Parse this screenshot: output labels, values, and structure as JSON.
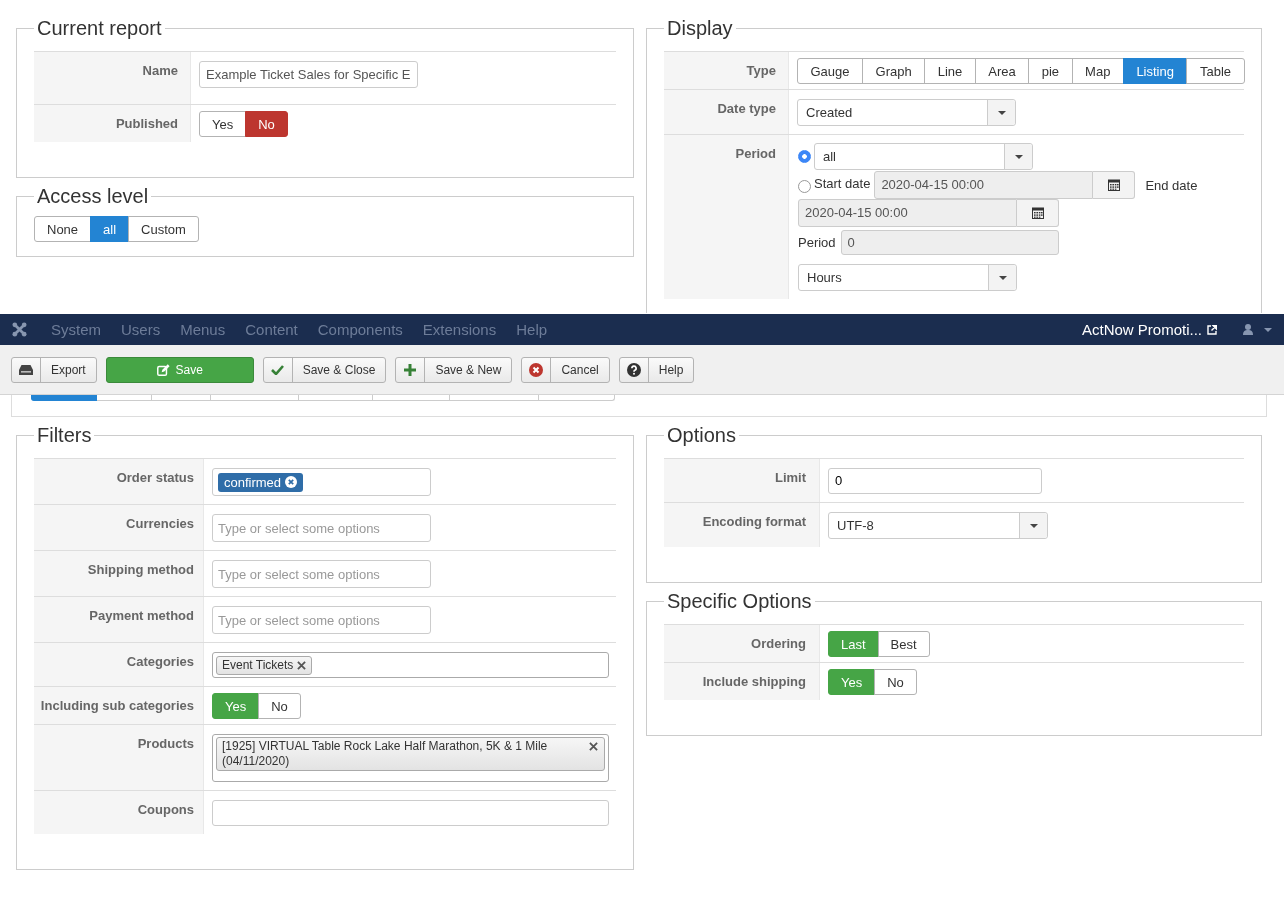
{
  "current_report": {
    "title": "Current report",
    "fields": [
      {
        "label": "Name",
        "kind": "text",
        "value": "Example Ticket Sales for Specific E"
      },
      {
        "label": "Published",
        "kind": "toggle",
        "options": [
          {
            "label": "Yes",
            "selected": false
          },
          {
            "label": "No",
            "selected": true,
            "color": "#bd362f"
          }
        ]
      }
    ]
  },
  "access_level": {
    "title": "Access level",
    "options": [
      {
        "label": "None",
        "selected": false
      },
      {
        "label": "all",
        "selected": true,
        "color": "#2384d3"
      },
      {
        "label": "Custom",
        "selected": false
      }
    ]
  },
  "display": {
    "title": "Display",
    "fields": [
      {
        "label": "Type",
        "kind": "toggle",
        "options": [
          {
            "label": "Gauge",
            "selected": false
          },
          {
            "label": "Graph",
            "selected": false
          },
          {
            "label": "Line",
            "selected": false
          },
          {
            "label": "Area",
            "selected": false
          },
          {
            "label": "pie",
            "selected": false
          },
          {
            "label": "Map",
            "selected": false
          },
          {
            "label": "Listing",
            "selected": true,
            "color": "#2384d3"
          },
          {
            "label": "Table",
            "selected": false
          }
        ]
      },
      {
        "label": "Date type",
        "kind": "select",
        "value": "Created"
      },
      {
        "label": "Period",
        "kind": "period",
        "choices": [
          {
            "kind": "preset",
            "selected": true,
            "value": "all"
          },
          {
            "kind": "range",
            "selected": false,
            "label": "Start date",
            "start": "2020-04-15 00:00",
            "end_label": "End date",
            "end": "2020-04-15 00:00"
          }
        ],
        "length_label": "Period",
        "length_value": "0",
        "unit": "Hours"
      }
    ]
  },
  "navbar": {
    "menu": [
      {
        "label": "System",
        "disabled": true
      },
      {
        "label": "Users",
        "disabled": true
      },
      {
        "label": "Menus",
        "disabled": true
      },
      {
        "label": "Content",
        "disabled": true
      },
      {
        "label": "Components",
        "disabled": true
      },
      {
        "label": "Extensions",
        "disabled": true
      },
      {
        "label": "Help",
        "disabled": true
      }
    ],
    "site_link": "ActNow Promoti..."
  },
  "toolbar": {
    "buttons": [
      {
        "label": "Export",
        "kind": "default"
      },
      {
        "label": "Save",
        "kind": "primary"
      },
      {
        "label": "Save & Close",
        "kind": "default"
      },
      {
        "label": "Save & New",
        "kind": "default"
      },
      {
        "label": "Cancel",
        "kind": "default"
      },
      {
        "label": "Help",
        "kind": "default"
      }
    ]
  },
  "tabs": [
    {
      "selected": true
    },
    {
      "selected": false
    },
    {
      "selected": false
    },
    {
      "selected": false
    },
    {
      "selected": false
    },
    {
      "selected": false
    },
    {
      "selected": false
    },
    {
      "selected": false
    }
  ],
  "filters": {
    "title": "Filters",
    "fields": [
      {
        "label": "Order status",
        "kind": "badges",
        "tags": [
          {
            "label": "confirmed"
          }
        ]
      },
      {
        "label": "Currencies",
        "kind": "chosen",
        "placeholder": "Type or select some options"
      },
      {
        "label": "Shipping method",
        "kind": "chosen",
        "placeholder": "Type or select some options"
      },
      {
        "label": "Payment method",
        "kind": "chosen",
        "placeholder": "Type or select some options"
      },
      {
        "label": "Categories",
        "kind": "tags",
        "tags": [
          {
            "label": "Event Tickets"
          }
        ]
      },
      {
        "label": "Including sub categories",
        "kind": "toggle",
        "options": [
          {
            "label": "Yes",
            "selected": true,
            "color": "#46a546"
          },
          {
            "label": "No",
            "selected": false
          }
        ]
      },
      {
        "label": "Products",
        "kind": "tags",
        "tags": [
          {
            "label": "[1925] VIRTUAL Table Rock Lake Half Marathon, 5K & 1 Mile (04/11/2020)"
          }
        ]
      },
      {
        "label": "Coupons",
        "kind": "text"
      }
    ]
  },
  "options": {
    "title": "Options",
    "fields": [
      {
        "label": "Limit",
        "kind": "text",
        "value": "0"
      },
      {
        "label": "Encoding format",
        "kind": "select",
        "value": "UTF-8"
      }
    ]
  },
  "specific_options": {
    "title": "Specific Options",
    "fields": [
      {
        "label": "Ordering",
        "kind": "toggle",
        "options": [
          {
            "label": "Last",
            "selected": true,
            "color": "#46a546"
          },
          {
            "label": "Best",
            "selected": false
          }
        ]
      },
      {
        "label": "Include shipping",
        "kind": "toggle",
        "options": [
          {
            "label": "Yes",
            "selected": true,
            "color": "#46a546"
          },
          {
            "label": "No",
            "selected": false
          }
        ]
      }
    ]
  }
}
